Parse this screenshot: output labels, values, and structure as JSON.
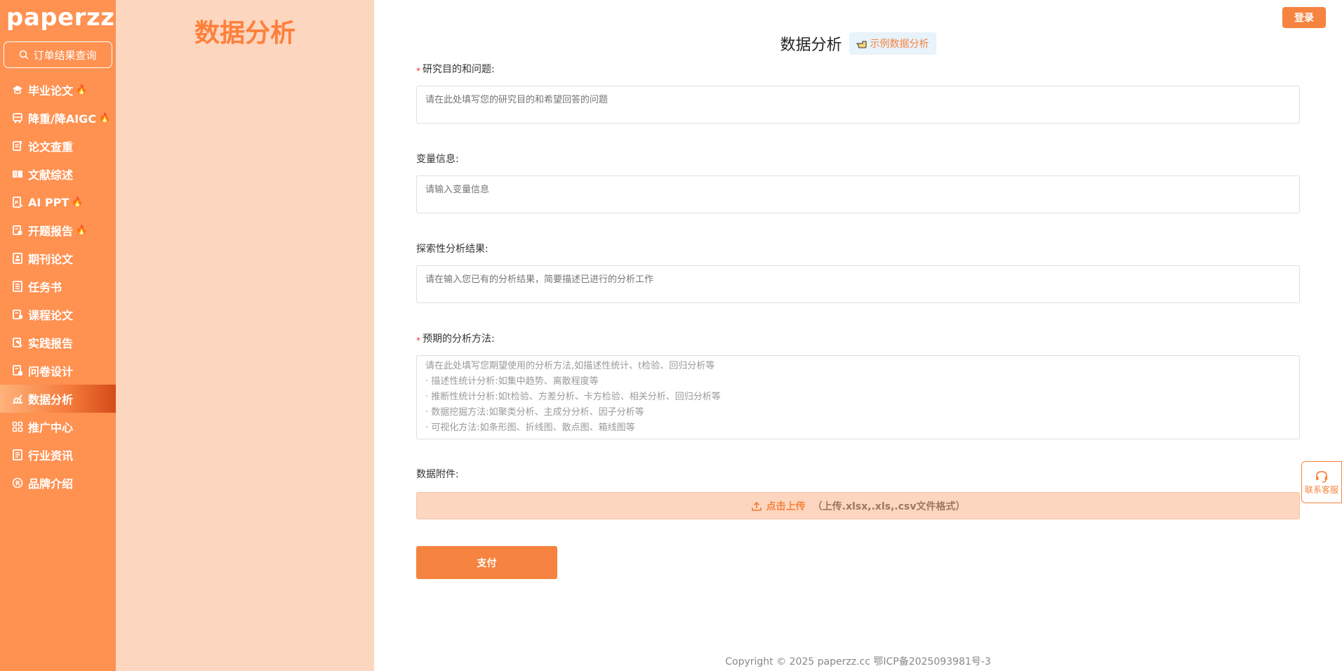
{
  "brand": {
    "logo": "paperzz",
    "accent": "#ff9151"
  },
  "sidebar": {
    "search_label": "订单结果查询",
    "items": [
      {
        "label": "毕业论文",
        "icon": "graduation-cap-icon",
        "hot": true
      },
      {
        "label": "降重/降AIGC",
        "icon": "bus-icon",
        "hot": true
      },
      {
        "label": "论文查重",
        "icon": "document-check-icon",
        "hot": false
      },
      {
        "label": "文献综述",
        "icon": "book-open-icon",
        "hot": false
      },
      {
        "label": "AI PPT",
        "icon": "ppt-icon",
        "hot": true
      },
      {
        "label": "开题报告",
        "icon": "report-icon",
        "hot": true
      },
      {
        "label": "期刊论文",
        "icon": "journal-icon",
        "hot": false
      },
      {
        "label": "任务书",
        "icon": "notebook-icon",
        "hot": false
      },
      {
        "label": "课程论文",
        "icon": "course-icon",
        "hot": false
      },
      {
        "label": "实践报告",
        "icon": "practice-icon",
        "hot": false
      },
      {
        "label": "问卷设计",
        "icon": "survey-icon",
        "hot": false
      },
      {
        "label": "数据分析",
        "icon": "chart-icon",
        "hot": false,
        "active": true
      },
      {
        "label": "推广中心",
        "icon": "grid-icon",
        "hot": false
      },
      {
        "label": "行业资讯",
        "icon": "news-icon",
        "hot": false
      },
      {
        "label": "品牌介绍",
        "icon": "registered-icon",
        "hot": false
      }
    ],
    "hot_glyph": "🔥"
  },
  "left_panel": {
    "title": "数据分析"
  },
  "header": {
    "login_label": "登录"
  },
  "page": {
    "title": "数据分析",
    "example_label": "示例数据分析"
  },
  "form": {
    "goal": {
      "label": "研究目的和问题:",
      "required_mark": "*",
      "placeholder": "请在此处填写您的研究目的和希望回答的问题"
    },
    "variables": {
      "label": "变量信息:",
      "placeholder": "请输入变量信息"
    },
    "exploratory": {
      "label": "探索性分析结果:",
      "placeholder": "请在输入您已有的分析结果，简要描述已进行的分析工作"
    },
    "methods": {
      "label": "预期的分析方法:",
      "required_mark": "*",
      "placeholder_lines": [
        "请在此处填写您期望使用的分析方法,如描述性统计、t检验、回归分析等",
        "· 描述性统计分析:如集中趋势、离散程度等",
        "· 推断性统计分析:如t检验、方差分析、卡方检验、相关分析、回归分析等",
        "· 数据挖掘方法:如聚类分析、主成分分析、因子分析等",
        "· 可视化方法:如条形图、折线图、散点图、箱线图等"
      ]
    },
    "attachment": {
      "label": "数据附件:",
      "upload_label": "点击上传",
      "upload_hint": "（上传.xlsx,.xls,.csv文件格式）"
    },
    "pay_label": "支付"
  },
  "footer": {
    "copyright": "Copyright © 2025 paperzz.cc 鄂ICP备2025093981号-3"
  },
  "service": {
    "label": "联系客服"
  }
}
